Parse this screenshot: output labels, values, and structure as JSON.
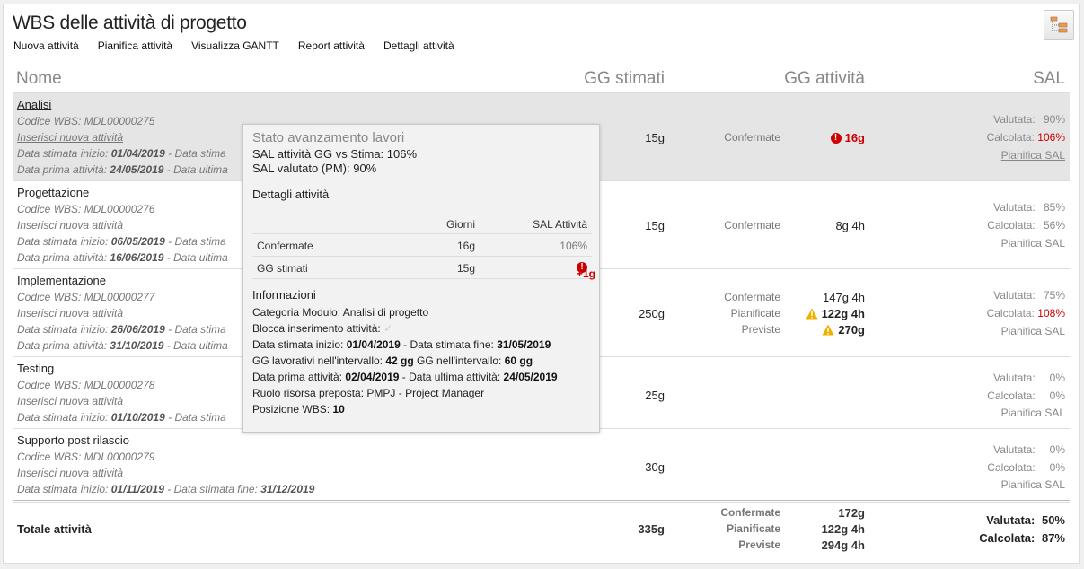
{
  "header": {
    "title": "WBS delle attività di progetto",
    "toolbar": [
      "Nuova attività",
      "Pianifica attività",
      "Visualizza GANTT",
      "Report attività",
      "Dettagli attività"
    ]
  },
  "columns": {
    "name": "Nome",
    "gg_stimati": "GG stimati",
    "gg_attivita": "GG attività",
    "sal": "SAL"
  },
  "rows": [
    {
      "name": "Analisi",
      "code": "Codice WBS: MDL00000275",
      "insert": "Inserisci nuova attività",
      "start_label": "Data stimata inizio:",
      "start": "01/04/2019",
      "end_label": "- Data stima",
      "first_label": "Data prima attività:",
      "first": "24/05/2019",
      "last_label": "- Data ultima",
      "gg": "15g",
      "act_labels": [
        "Confermate"
      ],
      "act_values": [
        "16g"
      ],
      "sal_valutata_label": "Valutata:",
      "sal_valutata": "90%",
      "sal_calcolata_label": "Calcolata:",
      "sal_calcolata": "106%",
      "pianifica": "Pianifica SAL"
    },
    {
      "name": "Progettazione",
      "code": "Codice WBS: MDL00000276",
      "insert": "Inserisci nuova attività",
      "start_label": "Data stimata inizio:",
      "start": "06/05/2019",
      "end_label": "- Data stima",
      "first_label": "Data prima attività:",
      "first": "16/06/2019",
      "last_label": "- Data ultima",
      "gg": "15g",
      "act_labels": [
        "Confermate"
      ],
      "act_values": [
        "8g 4h"
      ],
      "sal_valutata_label": "Valutata:",
      "sal_valutata": "85%",
      "sal_calcolata_label": "Calcolata:",
      "sal_calcolata": "56%",
      "pianifica": "Pianifica SAL"
    },
    {
      "name": "Implementazione",
      "code": "Codice WBS: MDL00000277",
      "insert": "Inserisci nuova attività",
      "start_label": "Data stimata inizio:",
      "start": "26/06/2019",
      "end_label": "- Data stima",
      "first_label": "Data prima attività:",
      "first": "31/10/2019",
      "last_label": "- Data ultima",
      "gg": "250g",
      "act_labels": [
        "Confermate",
        "Pianificate",
        "Previste"
      ],
      "act_values": [
        "147g 4h",
        "122g 4h",
        "270g"
      ],
      "sal_valutata_label": "Valutata:",
      "sal_valutata": "75%",
      "sal_calcolata_label": "Calcolata:",
      "sal_calcolata": "108%",
      "pianifica": "Pianifica SAL"
    },
    {
      "name": "Testing",
      "code": "Codice WBS: MDL00000278",
      "insert": "Inserisci nuova attività",
      "start_label": "Data stimata inizio:",
      "start": "01/10/2019",
      "end_label": "- Data stima",
      "gg": "25g",
      "sal_valutata_label": "Valutata:",
      "sal_valutata": "0%",
      "sal_calcolata_label": "Calcolata:",
      "sal_calcolata": "0%",
      "pianifica": "Pianifica SAL"
    },
    {
      "name": "Supporto post rilascio",
      "code": "Codice WBS: MDL00000279",
      "insert": "Inserisci nuova attività",
      "start_label": "Data stimata inizio:",
      "start": "01/11/2019",
      "end_label": "- Data stimata fine:",
      "end": "31/12/2019",
      "gg": "30g",
      "sal_valutata_label": "Valutata:",
      "sal_valutata": "0%",
      "sal_calcolata_label": "Calcolata:",
      "sal_calcolata": "0%",
      "pianifica": "Pianifica SAL"
    }
  ],
  "totals": {
    "label": "Totale attività",
    "gg": "335g",
    "act_labels": [
      "Confermate",
      "Pianificate",
      "Previste"
    ],
    "act_values": [
      "172g",
      "122g 4h",
      "294g 4h"
    ],
    "valutata_label": "Valutata:",
    "valutata": "50%",
    "calcolata_label": "Calcolata:",
    "calcolata": "87%"
  },
  "tooltip": {
    "title": "Stato avanzamento lavori",
    "line1": "SAL attività GG vs Stima: 106%",
    "line2": "SAL valutato (PM): 90%",
    "details_title": "Dettagli attività",
    "table_head": [
      "Giorni",
      "SAL Attività"
    ],
    "table_rows": [
      {
        "label": "Confermate",
        "days": "16g",
        "sal": "106%"
      },
      {
        "label": "GG stimati",
        "days": "15g",
        "sal": "+1g"
      }
    ],
    "info_title": "Informazioni",
    "info": {
      "categoria": "Categoria Modulo: Analisi di progetto",
      "blocca": "Blocca inserimento attività:",
      "start_label": "Data stimata inizio:",
      "start": "01/04/2019",
      "end_label": "- Data stimata fine:",
      "end": "31/05/2019",
      "gg_lav_label": "GG lavorativi nell'intervallo:",
      "gg_lav": "42 gg",
      "gg_int_label": "GG nell'intervallo:",
      "gg_int": "60 gg",
      "first_label": "Data prima attività:",
      "first": "02/04/2019",
      "last_label": "- Data ultima attività:",
      "last": "24/05/2019",
      "ruolo": "Ruolo risorsa preposta: PMPJ - Project Manager",
      "posizione_label": "Posizione WBS:",
      "posizione": "10"
    }
  },
  "colors": {
    "error": "#cc0000",
    "warning": "#f0b000",
    "selected_row": "#e5e5e5"
  }
}
